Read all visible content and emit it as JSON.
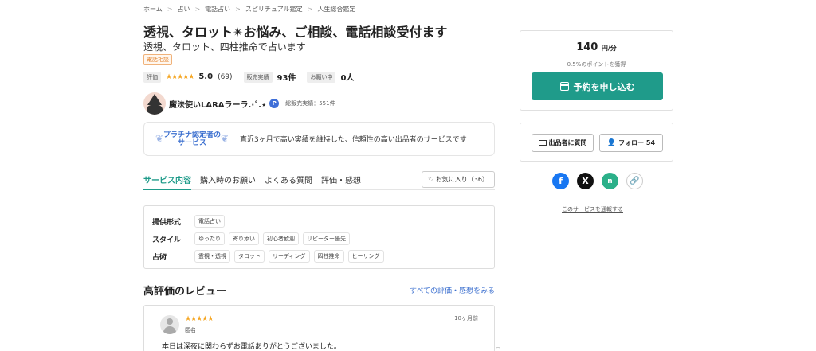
{
  "breadcrumb": [
    "ホーム",
    "占い",
    "電話占い",
    "スピリチュアル鑑定",
    "人生総合鑑定"
  ],
  "breadcrumb_sep": ">",
  "title": "透視、タロット✴お悩み、ご相談、電話相談受付ます",
  "subtitle": "透視、タロット、四柱推命で占います",
  "category_tag": "電話相談",
  "stats": {
    "rating_label": "評価",
    "stars": "★★★★★",
    "rating": "5.0",
    "rating_count": "(69)",
    "sales_label": "販売実績",
    "sales_value": "93件",
    "favorites_label": "お願い中",
    "favorites_value": "0人"
  },
  "seller": {
    "name": "魔法使いLARAラーラ.·˚.⋆",
    "badge": "P",
    "total_sales": "総販売実績：551件"
  },
  "platinum": {
    "badge_line1": "プラチナ認定者の",
    "badge_line2": "サービス",
    "description": "直近3ヶ月で高い実績を維持した、信頼性の高い出品者のサービスです"
  },
  "tabs": [
    "サービス内容",
    "購入時のお願い",
    "よくある質問",
    "評価・感想"
  ],
  "favorite_button": "お気に入り（36）",
  "specs": [
    {
      "label": "提供形式",
      "chips": [
        "電話占い"
      ]
    },
    {
      "label": "スタイル",
      "chips": [
        "ゆったり",
        "寄り添い",
        "初心者歓迎",
        "リピーター優先"
      ]
    },
    {
      "label": "占術",
      "chips": [
        "霊視・透視",
        "タロット",
        "リーディング",
        "四柱推命",
        "ヒーリング"
      ]
    }
  ],
  "reviews": {
    "heading": "高評価のレビュー",
    "see_all": "すべての評価・感想をみる",
    "items": [
      {
        "stars": "★★★★★",
        "name": "匿名",
        "date": "10ヶ月前",
        "text": "本日は深夜に関わらずお電話ありがとうございました。"
      }
    ]
  },
  "pricing": {
    "price": "140",
    "unit": "円/分",
    "points": "0.5%のポイントを獲得",
    "book_button": "予約を申し込む"
  },
  "actions": {
    "ask": "出品者に質問",
    "follow": "フォロー 54"
  },
  "social": {
    "facebook": "f",
    "x": "X",
    "note": "n",
    "link": "🔗"
  },
  "report_link": "このサービスを通報する",
  "colors": {
    "accent": "#1f9b8a",
    "star": "#f5a623",
    "link": "#3b6fcf",
    "tag_orange": "#e07a1f"
  },
  "icons": [
    "calendar-icon",
    "mail-icon",
    "person-plus-icon",
    "heart-icon",
    "facebook-icon",
    "x-icon",
    "note-icon",
    "link-icon",
    "laurel-icon"
  ]
}
